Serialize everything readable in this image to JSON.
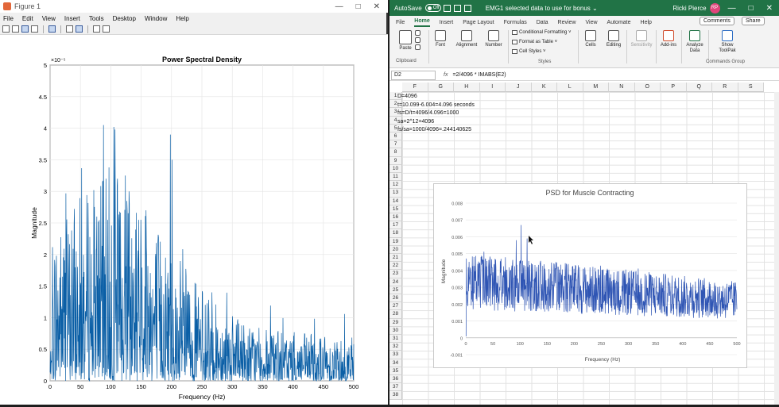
{
  "figure": {
    "window_title": "Figure 1",
    "menu": [
      "File",
      "Edit",
      "View",
      "Insert",
      "Tools",
      "Desktop",
      "Window",
      "Help"
    ],
    "plot": {
      "title": "Power Spectral Density",
      "xlabel": "Frequency (Hz)",
      "ylabel": "Magnitude",
      "exponent": "×10⁻⁵",
      "xticks": [
        "0",
        "50",
        "100",
        "150",
        "200",
        "250",
        "300",
        "350",
        "400",
        "450",
        "500"
      ],
      "yticks": [
        "0",
        "0.5",
        "1",
        "1.5",
        "2",
        "2.5",
        "3",
        "3.5",
        "4",
        "4.5",
        "5"
      ],
      "line_color": "#0b5fa6"
    }
  },
  "excel": {
    "autosave_label": "AutoSave",
    "autosave_state": "Off",
    "doc_title": "EMG1 selected data to use for bonus ⌄",
    "user": "Ricki Pierce",
    "user_initials": "RP",
    "tabs": [
      "File",
      "Home",
      "Insert",
      "Page Layout",
      "Formulas",
      "Data",
      "Review",
      "View",
      "Automate",
      "Help"
    ],
    "comments_label": "Comments",
    "share_label": "Share",
    "ribbon": {
      "clipboard": {
        "paste": "Paste",
        "group": "Clipboard"
      },
      "font": "Font",
      "alignment": "Alignment",
      "number": "Number",
      "conditional_formatting": "Conditional Formatting ˅",
      "format_as_table": "Format as Table ˅",
      "cell_styles": "Cell Styles ˅",
      "styles_group": "Styles",
      "cells": "Cells",
      "editing": "Editing",
      "sensitivity": "Sensitivity",
      "add_ins": "Add-ins",
      "analyze_data": "Analyze Data",
      "show_toolpak": "Show ToolPak",
      "commands_group": "Commands Group"
    },
    "name_box": "D2",
    "formula": "=2/4096 * IMABS(E2)",
    "columns": [
      "F",
      "G",
      "H",
      "I",
      "J",
      "K",
      "L",
      "M",
      "N",
      "O",
      "P",
      "Q",
      "R",
      "S"
    ],
    "rows": [
      "1",
      "2",
      "3",
      "4",
      "5",
      "6",
      "7",
      "8",
      "9",
      "10",
      "11",
      "12",
      "13",
      "14",
      "15",
      "16",
      "17",
      "18",
      "19",
      "20",
      "21",
      "22",
      "23",
      "24",
      "25",
      "26",
      "27",
      "28",
      "29",
      "30",
      "31",
      "32",
      "33",
      "34",
      "35",
      "36",
      "37",
      "38"
    ],
    "cells": [
      "D=4096",
      "t=10.099-6.004=4.096 seconds",
      "fs=D/t=4096/4.096=1000",
      "sa=2^12=4096",
      "fs/sa=1000/4096=.244140625"
    ],
    "chart": {
      "title": "PSD for Muscle Contracting",
      "xlabel": "Frequency (Hz)",
      "ylabel": "Magnitude",
      "xticks": [
        "0",
        "50",
        "100",
        "150",
        "200",
        "250",
        "300",
        "350",
        "400",
        "450",
        "500"
      ],
      "yticks": [
        "-0.001",
        "0",
        "0.001",
        "0.002",
        "0.003",
        "0.004",
        "0.005",
        "0.006",
        "0.007",
        "0.008"
      ],
      "line_color": "#2f55b4"
    },
    "colors": {
      "brand": "#217346"
    }
  }
}
